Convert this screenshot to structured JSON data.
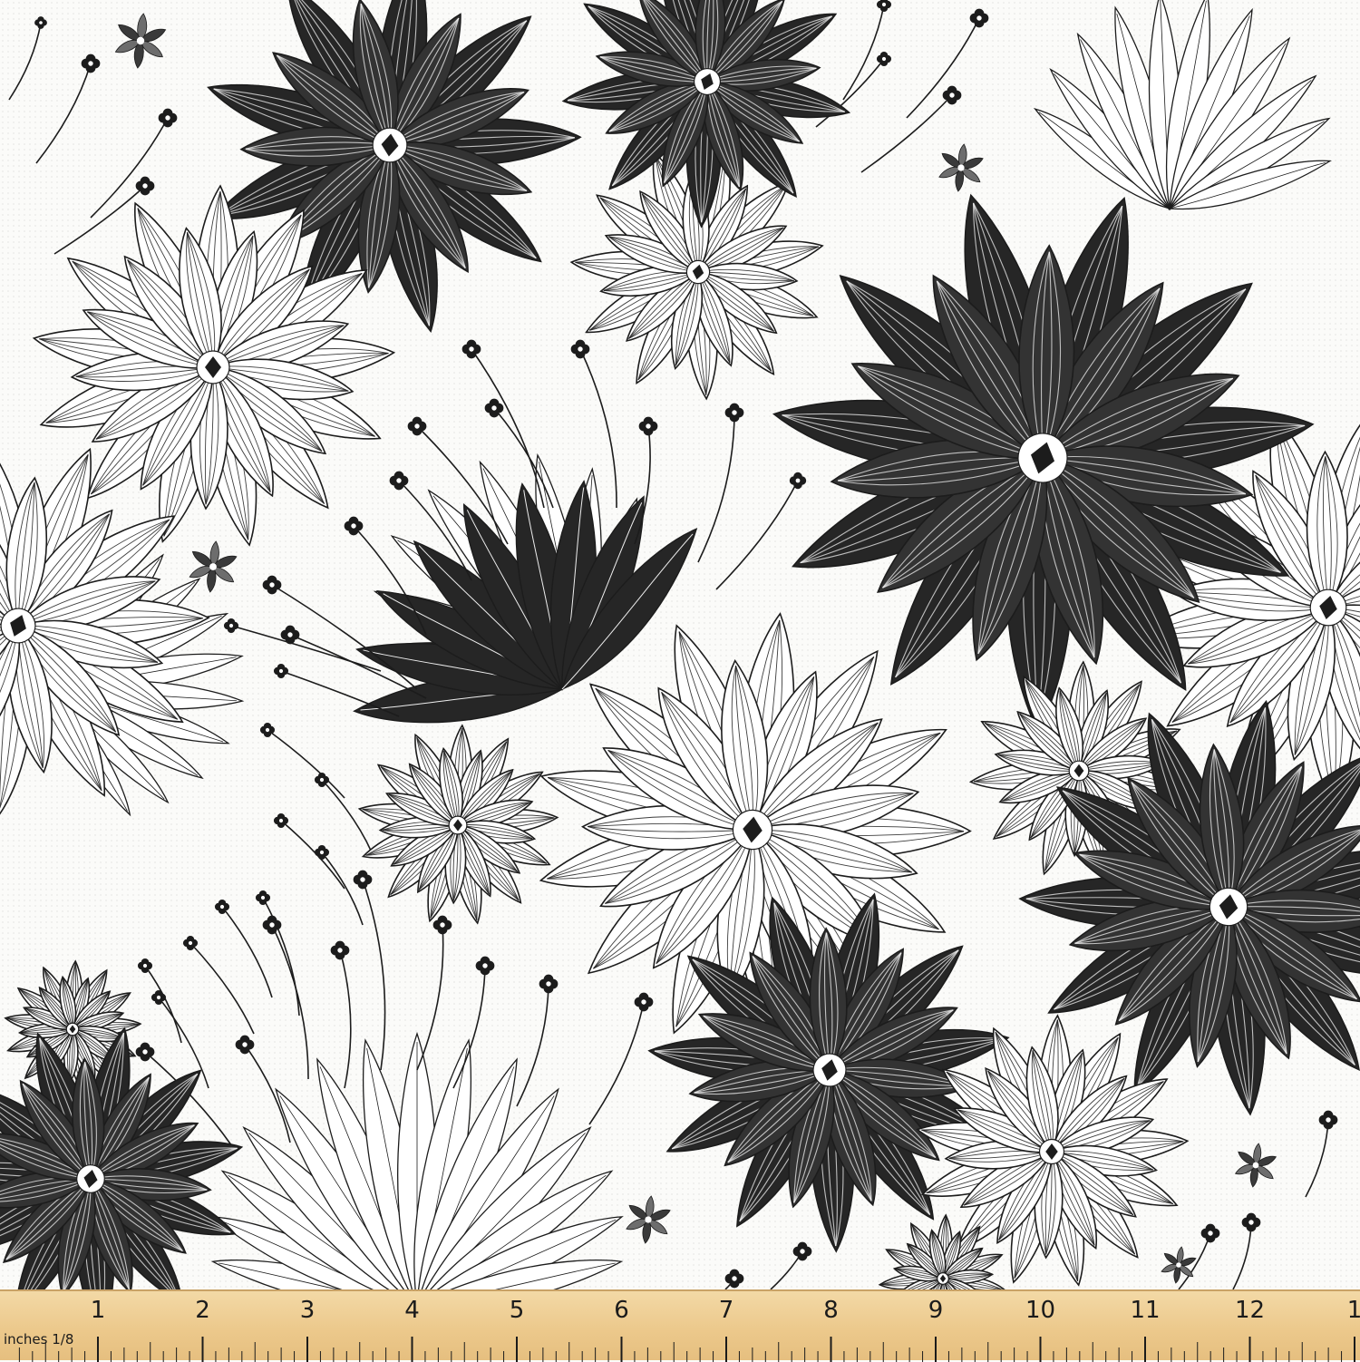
{
  "colors": {
    "background": "#fbfbf9",
    "ink": "#1c1c1c",
    "dark_petal": "#262626",
    "light_petal": "#ffffff",
    "ruler": "#ecc98c",
    "ruler_ink": "#1b1b1b"
  },
  "ruler": {
    "unit_label": "inches 1/8",
    "numbers": [
      "1",
      "2",
      "3",
      "4",
      "5",
      "6",
      "7",
      "8",
      "9",
      "10",
      "11",
      "12",
      "1"
    ]
  },
  "pattern": {
    "style": "monochrome floral fabric print",
    "motifs": [
      "dark-flower",
      "outline-flower",
      "small-bud",
      "mini-star-flower"
    ]
  }
}
